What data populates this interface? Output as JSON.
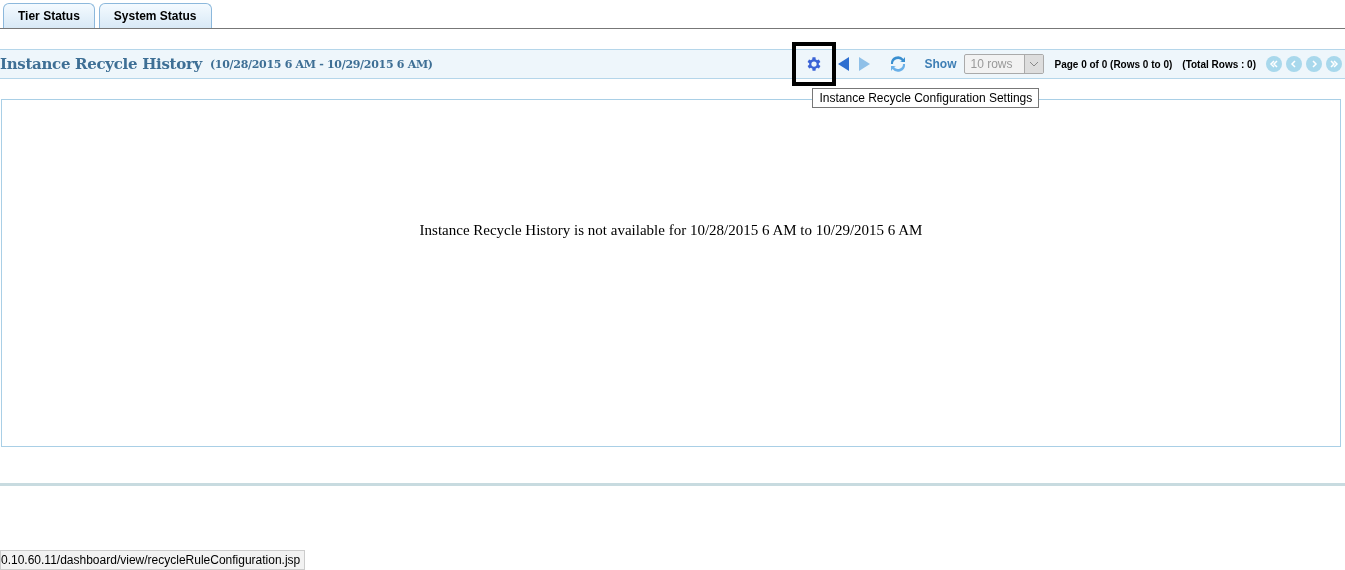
{
  "tabs": [
    {
      "label": "Tier Status"
    },
    {
      "label": "System Status"
    }
  ],
  "header": {
    "title": "Instance Recycle History",
    "range": "(10/28/2015 6 AM - 10/29/2015 6 AM)"
  },
  "toolbar": {
    "show_label": "Show",
    "rows_select": {
      "value": "10 rows",
      "disabled": true
    },
    "page_info": "Page 0 of 0 (Rows 0 to 0)",
    "total_rows": "(Total Rows : 0)"
  },
  "tooltip": "Instance Recycle Configuration Settings",
  "message": "Instance Recycle History is not available for 10/28/2015 6 AM to 10/29/2015 6 AM",
  "status_url": "0.10.60.11/dashboard/view/recycleRuleConfiguration.jsp"
}
